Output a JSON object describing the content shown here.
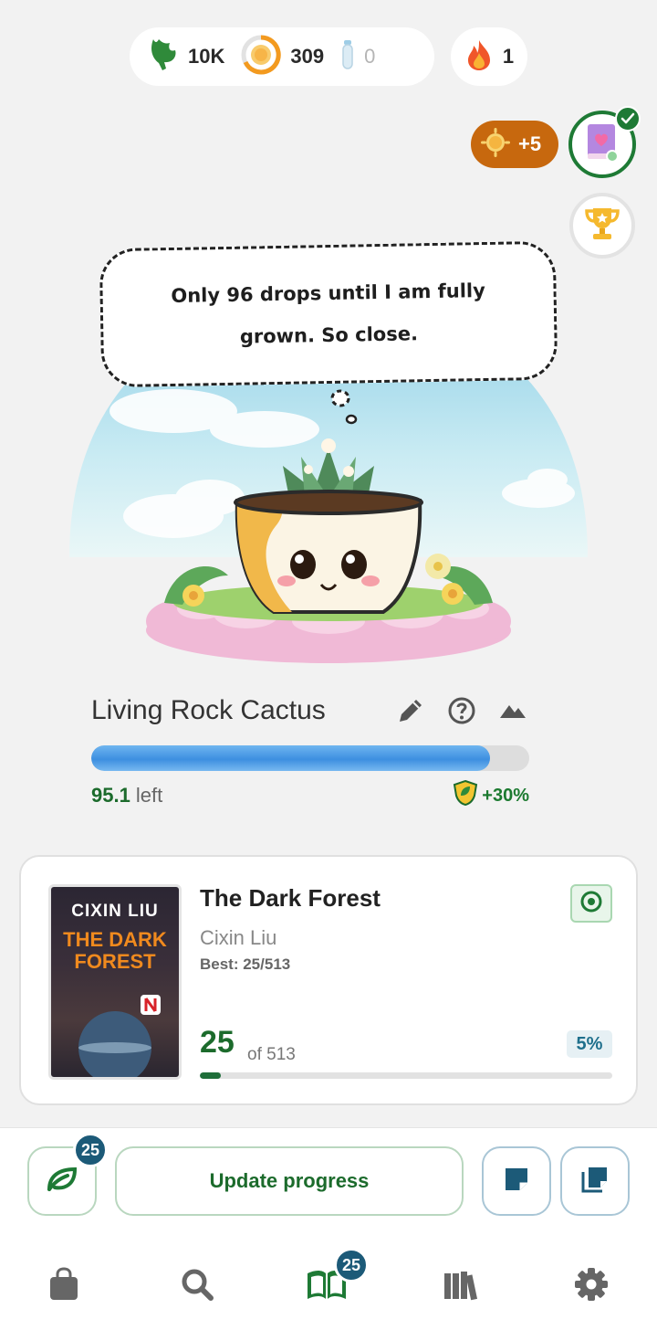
{
  "stats": {
    "leaves": "10K",
    "coins": "309",
    "potions": "0",
    "streak": "1"
  },
  "reward": {
    "label": "+5"
  },
  "thought": {
    "text": "Only 96 drops until I am fully grown. So close."
  },
  "plant": {
    "name": "Living Rock Cactus",
    "progress_percent": 91,
    "left_value": "95.1",
    "left_label": "left",
    "boost": "+30%"
  },
  "book": {
    "cover_author": "CIXIN LIU",
    "cover_title": "THE DARK FOREST",
    "title": "The Dark Forest",
    "author": "Cixin Liu",
    "best": "Best: 25/513",
    "current_page": "25",
    "of_pages": "of 513",
    "percent_label": "5%",
    "progress_percent": 5
  },
  "actions": {
    "leaf_count": "25",
    "update_label": "Update progress"
  },
  "nav": {
    "reading_count": "25"
  },
  "colors": {
    "primary_green": "#1c6b2c",
    "badge_blue": "#1c5a78",
    "reward_orange": "#c7680e",
    "progress_blue": "#3d8fe0"
  }
}
